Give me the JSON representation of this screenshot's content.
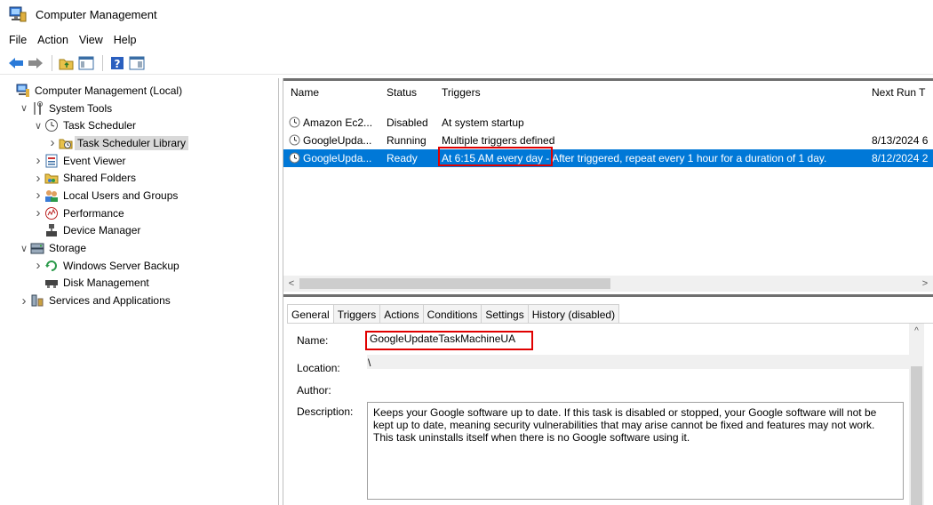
{
  "window": {
    "title": "Computer Management"
  },
  "menu": [
    "File",
    "Action",
    "View",
    "Help"
  ],
  "tree": [
    {
      "label": "Computer Management (Local)",
      "indent": 0,
      "exp": "",
      "icon": "computer-management-icon"
    },
    {
      "label": "System Tools",
      "indent": 1,
      "exp": "v",
      "icon": "tools-icon"
    },
    {
      "label": "Task Scheduler",
      "indent": 2,
      "exp": "v",
      "icon": "clock-icon"
    },
    {
      "label": "Task Scheduler Library",
      "indent": 3,
      "exp": ">",
      "icon": "folder-clock-icon",
      "selected": true
    },
    {
      "label": "Event Viewer",
      "indent": 2,
      "exp": ">",
      "icon": "event-viewer-icon"
    },
    {
      "label": "Shared Folders",
      "indent": 2,
      "exp": ">",
      "icon": "shared-folders-icon"
    },
    {
      "label": "Local Users and Groups",
      "indent": 2,
      "exp": ">",
      "icon": "users-icon"
    },
    {
      "label": "Performance",
      "indent": 2,
      "exp": ">",
      "icon": "performance-icon"
    },
    {
      "label": "Device Manager",
      "indent": 2,
      "exp": "",
      "icon": "device-manager-icon"
    },
    {
      "label": "Storage",
      "indent": 1,
      "exp": "v",
      "icon": "storage-icon"
    },
    {
      "label": "Windows Server Backup",
      "indent": 2,
      "exp": ">",
      "icon": "backup-icon"
    },
    {
      "label": "Disk Management",
      "indent": 2,
      "exp": "",
      "icon": "disk-icon"
    },
    {
      "label": "Services and Applications",
      "indent": 1,
      "exp": ">",
      "icon": "services-icon"
    }
  ],
  "columns": [
    "Name",
    "Status",
    "Triggers",
    "Next Run T"
  ],
  "tasks": [
    {
      "name": "Amazon Ec2...",
      "status": "Disabled",
      "triggers": "At system startup",
      "triggers_rest": "",
      "next": ""
    },
    {
      "name": "GoogleUpda...",
      "status": "Running",
      "triggers": "Multiple triggers defined",
      "triggers_rest": "",
      "next": "8/13/2024 6"
    },
    {
      "name": "GoogleUpda...",
      "status": "Ready",
      "triggers": "At 6:15 AM every day",
      "triggers_rest": " - After triggered, repeat every 1 hour for a duration of 1 day.",
      "next": "8/12/2024 2",
      "selected": true
    }
  ],
  "tabs": [
    "General",
    "Triggers",
    "Actions",
    "Conditions",
    "Settings",
    "History (disabled)"
  ],
  "details": {
    "name_label": "Name:",
    "name_value": "GoogleUpdateTaskMachineUA",
    "location_label": "Location:",
    "location_value": "\\",
    "author_label": "Author:",
    "description_label": "Description:",
    "description_value": "Keeps your Google software up to date. If this task is disabled or stopped, your Google software will not be kept up to date, meaning security vulnerabilities that may arise cannot be fixed and features may not work. This task uninstalls itself when there is no Google software using it."
  },
  "colors": {
    "selection": "#0078d7",
    "highlight": "#e00000"
  }
}
